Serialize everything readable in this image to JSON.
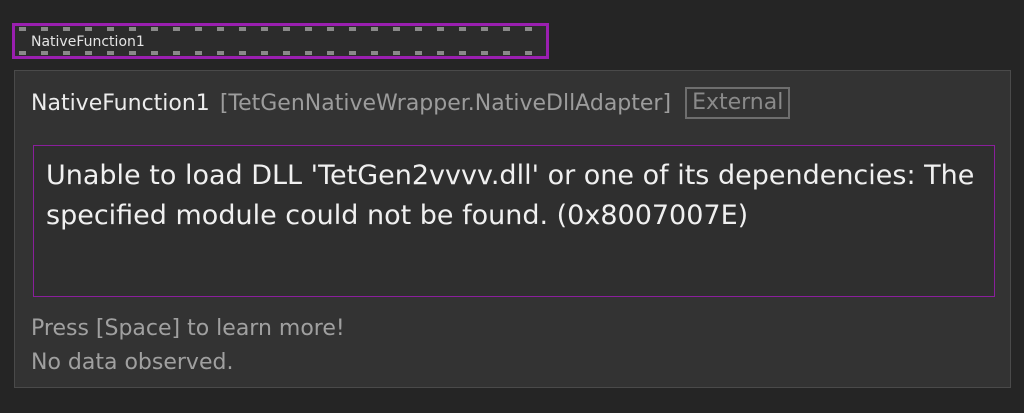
{
  "node": {
    "title": "NativeFunction1"
  },
  "tooltip": {
    "name": "NativeFunction1",
    "type": "[TetGenNativeWrapper.NativeDllAdapter]",
    "badge": "External",
    "error": "Unable to load DLL 'TetGen2vvvv.dll' or one of its dependencies: The specified module could not be found. (0x8007007E)",
    "hint": "Press [Space] to learn more!",
    "status": "No data observed."
  },
  "colors": {
    "selection": "#9a1fb0",
    "error_border": "#8a1f9c",
    "background": "#252525"
  }
}
